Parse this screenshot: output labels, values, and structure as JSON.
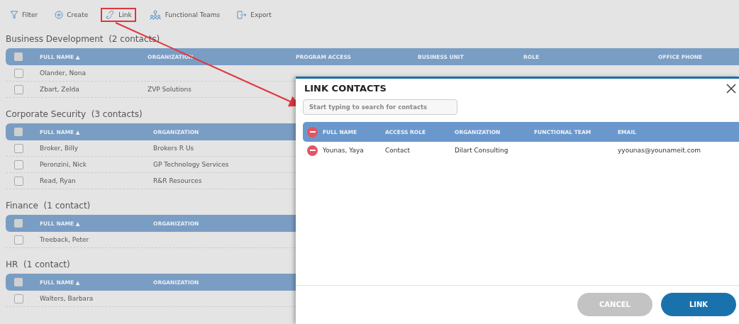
{
  "toolbar": [
    {
      "kind": "filter",
      "label": "Filter",
      "highlighted": false
    },
    {
      "kind": "create",
      "label": "Create",
      "highlighted": false
    },
    {
      "kind": "link",
      "label": "Link",
      "highlighted": true
    },
    {
      "kind": "teams",
      "label": "Functional Teams",
      "highlighted": false
    },
    {
      "kind": "export",
      "label": "Export",
      "highlighted": false
    }
  ],
  "groups": [
    {
      "title": "Business Development",
      "count": "(2 contacts)",
      "all_checked": false,
      "columns": [
        "FULL NAME ▲",
        "ORGANIZATION",
        "PROGRAM ACCESS",
        "BUSINESS UNIT",
        "ROLE",
        "OFFICE PHONE"
      ],
      "rows": [
        {
          "checked": false,
          "cells": [
            "Olander, Nona",
            ""
          ]
        },
        {
          "checked": false,
          "cells": [
            "Zbart, Zelda",
            "ZVP Solutions"
          ]
        }
      ]
    },
    {
      "title": "Corporate Security",
      "count": "(3 contacts)",
      "all_checked": false,
      "columns": [
        "FULL NAME ▲",
        "ORGANIZATION"
      ],
      "rows": [
        {
          "checked": false,
          "cells": [
            "Broker, Billy",
            "Brokers R Us"
          ]
        },
        {
          "checked": false,
          "cells": [
            "Peronzini, Nick",
            "GP Technology Services"
          ]
        },
        {
          "checked": false,
          "cells": [
            "Read, Ryan",
            "R&R Resources"
          ]
        }
      ]
    },
    {
      "title": "Finance",
      "count": "(1 contact)",
      "all_checked": false,
      "columns": [
        "FULL NAME ▲",
        "ORGANIZATION"
      ],
      "rows": [
        {
          "checked": false,
          "cells": [
            "Treeback, Peter",
            ""
          ]
        }
      ]
    },
    {
      "title": "HR",
      "count": "(1 contact)",
      "all_checked": false,
      "columns": [
        "FULL NAME ▲",
        "ORGANIZATION"
      ],
      "rows": [
        {
          "checked": false,
          "cells": [
            "Walters, Barbara",
            ""
          ]
        }
      ]
    }
  ],
  "dialog": {
    "title": "LINK CONTACTS",
    "search": {
      "placeholder": "Start typing to search for contacts"
    },
    "columns": [
      "FULL NAME",
      "ACCESS ROLE",
      "ORGANIZATION",
      "FUNCTIONAL TEAM",
      "EMAIL"
    ],
    "rows": [
      {
        "cells": [
          "Younas, Yaya",
          "Contact",
          "Dilart Consulting",
          "",
          "yyounas@younameit.com"
        ]
      }
    ],
    "buttons": [
      {
        "label": "CANCEL",
        "kind": "secondary"
      },
      {
        "label": "LINK",
        "kind": "primary"
      }
    ]
  }
}
